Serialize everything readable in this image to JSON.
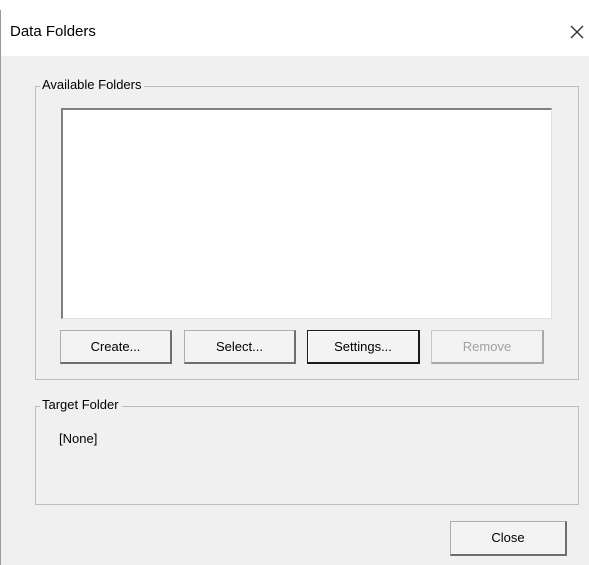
{
  "window": {
    "title": "Data Folders",
    "close_icon": "close-x-icon"
  },
  "available_folders": {
    "label": "Available Folders",
    "items": [],
    "buttons": {
      "create": "Create...",
      "select": "Select...",
      "settings": "Settings...",
      "remove": "Remove"
    },
    "remove_disabled": true,
    "settings_is_default": true
  },
  "target_folder": {
    "label": "Target Folder",
    "value": "[None]"
  },
  "footer": {
    "close": "Close"
  }
}
